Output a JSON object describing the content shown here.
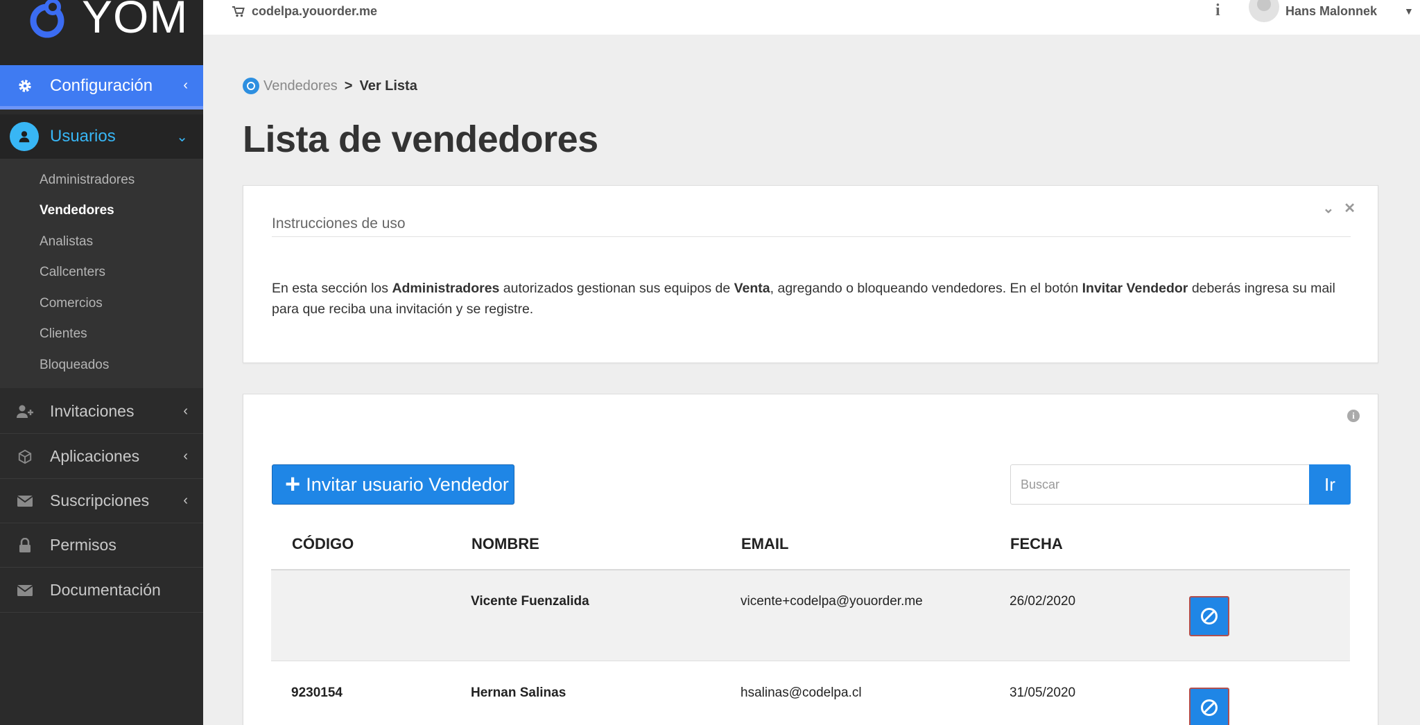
{
  "brand": {
    "logo_text": "YOM"
  },
  "colors": {
    "primary": "#1f86e6",
    "sidebar_bg": "#2b2b2b",
    "active_nav": "#3f7bf2",
    "users_accent": "#38b6f5"
  },
  "topbar": {
    "site": "codelpa.youorder.me",
    "info_icon": "i",
    "user_name": "Hans Malonnek"
  },
  "sidebar": {
    "config": {
      "label": "Configuración",
      "icon": "gear-icon"
    },
    "users": {
      "label": "Usuarios",
      "icon": "user-icon"
    },
    "submenu": [
      "Administradores",
      "Vendedores",
      "Analistas",
      "Callcenters",
      "Comercios",
      "Clientes",
      "Bloqueados"
    ],
    "active_sub": "Vendedores",
    "items": [
      {
        "label": "Invitaciones",
        "icon": "user-plus-icon"
      },
      {
        "label": "Aplicaciones",
        "icon": "cube-icon"
      },
      {
        "label": "Suscripciones",
        "icon": "envelope-icon"
      },
      {
        "label": "Permisos",
        "icon": "lock-icon"
      },
      {
        "label": "Documentación",
        "icon": "envelope-icon"
      }
    ]
  },
  "breadcrumb": {
    "link": "Vendedores",
    "separator": ">",
    "current": "Ver Lista"
  },
  "page": {
    "title": "Lista de vendedores"
  },
  "instructions": {
    "title": "Instrucciones de uso",
    "t1": "En esta sección los ",
    "b1": "Administradores",
    "t2": " autorizados gestionan sus equipos de ",
    "b2": "Venta",
    "t3": ", agregando o bloqueando vendedores. En el botón ",
    "b3": "Invitar Vendedor",
    "t4": " deberás ingresa su mail para que reciba una invitación y se registre."
  },
  "list": {
    "invite_label": "Invitar usuario Vendedor",
    "search_placeholder": "Buscar",
    "search_button": "Ir",
    "columns": [
      "CÓDIGO",
      "NOMBRE",
      "EMAIL",
      "FECHA"
    ],
    "rows": [
      {
        "code": "",
        "name": "Vicente Fuenzalida",
        "email": "vicente+codelpa@youorder.me",
        "date": "26/02/2020"
      },
      {
        "code": "9230154",
        "name": "Hernan Salinas",
        "email": "hsalinas@codelpa.cl",
        "date": "31/05/2020"
      }
    ]
  }
}
